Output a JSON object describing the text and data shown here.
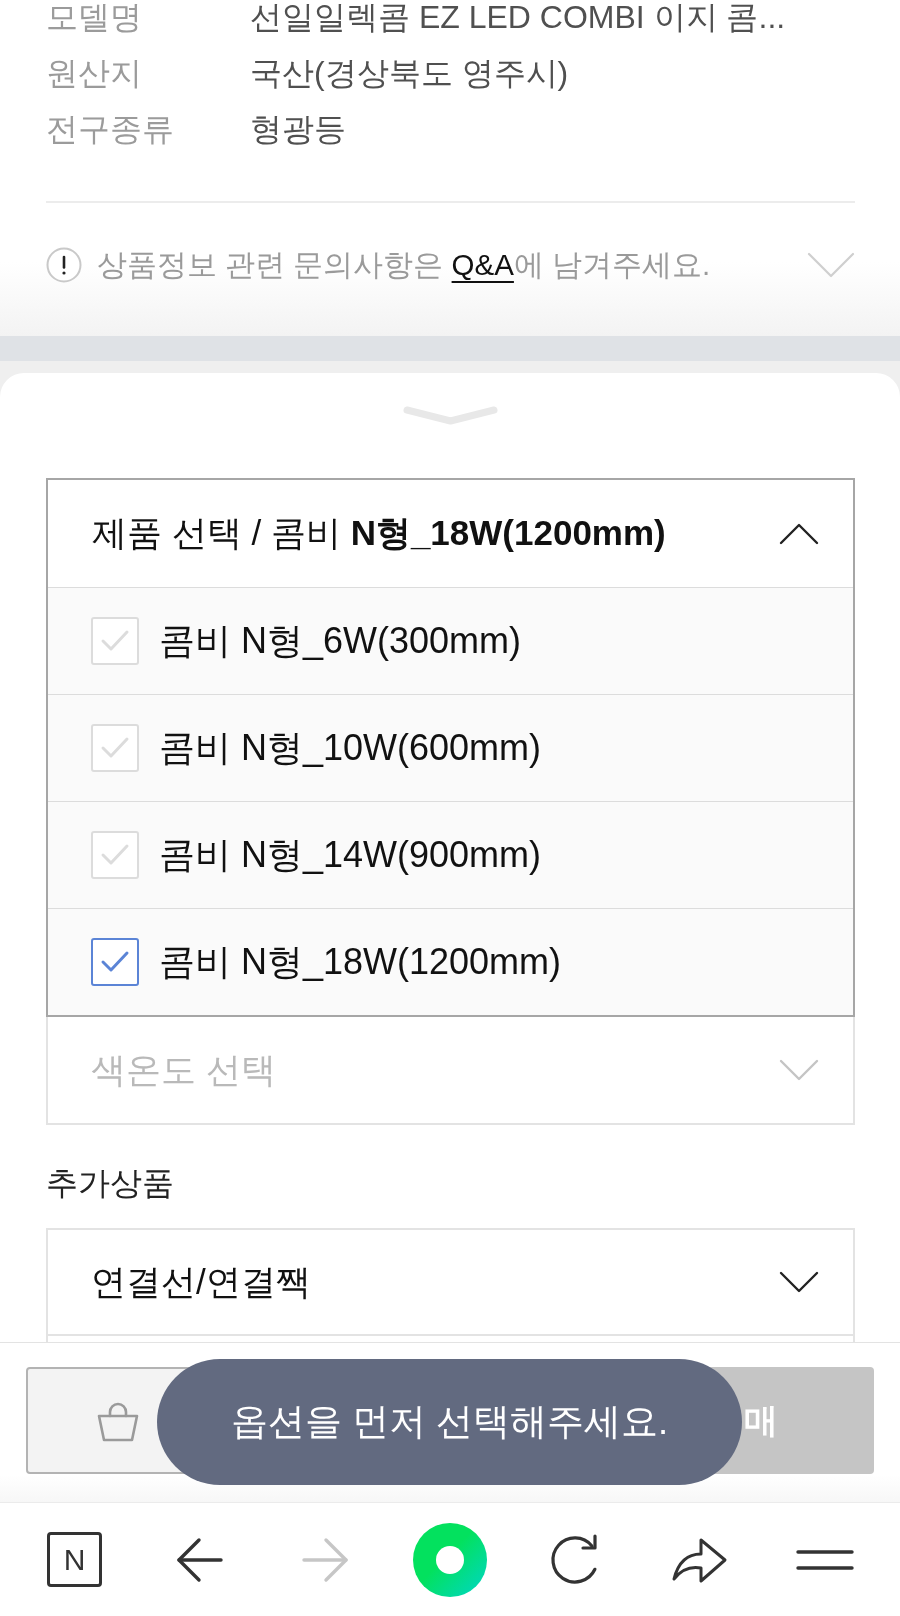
{
  "spec_rows": [
    {
      "label": "모델명",
      "value": "선일일렉콤 EZ LED COMBI 이지 콤..."
    },
    {
      "label": "원산지",
      "value": "국산(경상북도 영주시)"
    },
    {
      "label": "전구종류",
      "value": "형광등"
    }
  ],
  "notice": {
    "text": "상품정보 관련 문의사항은 ",
    "link": "Q&A",
    "text_end": "에 남겨주세요."
  },
  "product_select": {
    "title": "제품 선택 / 콤비 **N형_18W(1200mm)**",
    "expanded": true,
    "options": [
      {
        "label": "콤비 N형_6W(300mm)",
        "selected": false
      },
      {
        "label": "콤비 N형_10W(600mm)",
        "selected": false
      },
      {
        "label": "콤비 N형_14W(900mm)",
        "selected": false
      },
      {
        "label": "콤비 N형_18W(1200mm)",
        "selected": true
      }
    ]
  },
  "color_select": {
    "placeholder": "색온도 선택",
    "expanded": false,
    "disabled": true
  },
  "addons": {
    "label": "추가상품",
    "select": {
      "value": "연결선/연결짹",
      "expanded": false,
      "disabled": false
    }
  },
  "buy_button": {
    "label": "매",
    "disabled": true
  },
  "toast": {
    "text": "옵션을 먼저 선택해주세요."
  },
  "toolbar": [
    {
      "kind": "logo",
      "label": "N",
      "disabled": false
    },
    {
      "kind": "back",
      "disabled": false
    },
    {
      "kind": "forward",
      "disabled": true
    },
    {
      "kind": "dot",
      "disabled": false
    },
    {
      "kind": "reload",
      "disabled": false
    },
    {
      "kind": "share",
      "disabled": false
    },
    {
      "kind": "menu",
      "disabled": false
    }
  ]
}
